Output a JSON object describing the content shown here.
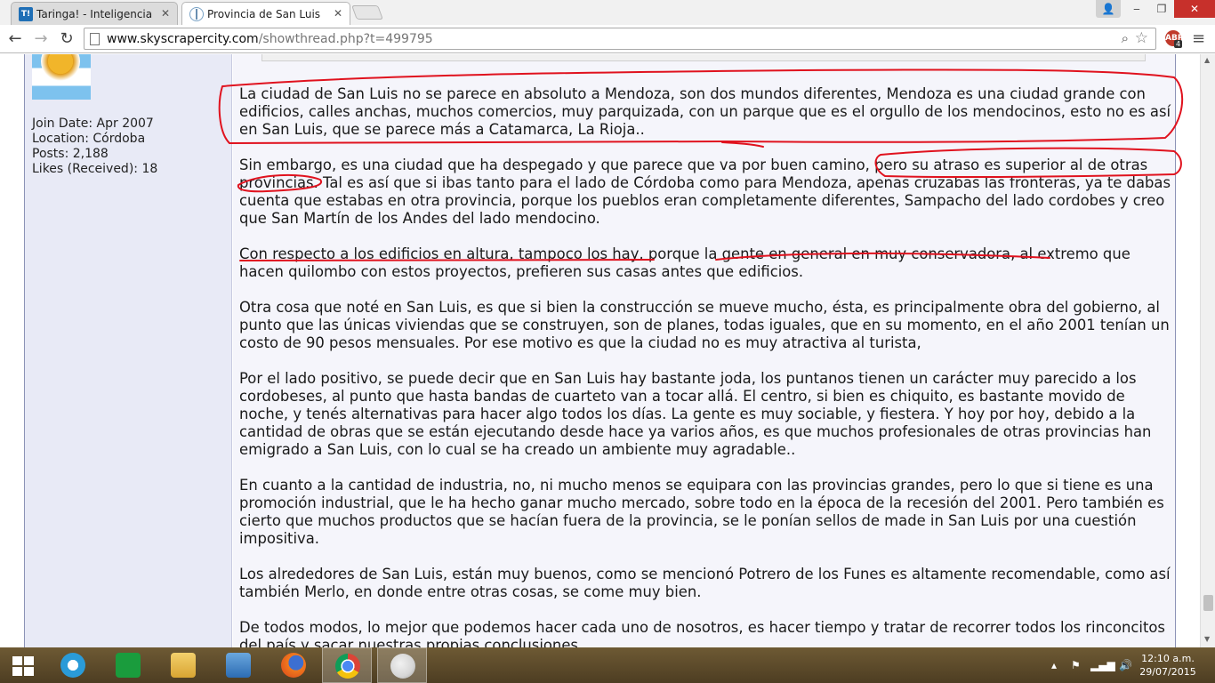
{
  "browser": {
    "tabs": [
      {
        "title": "Taringa! - Inteligencia col",
        "favicon": "taringa-favicon-icon",
        "active": false
      },
      {
        "title": "Provincia de San Luis com",
        "favicon": "skyscrapercity-favicon-icon",
        "active": true
      }
    ],
    "url_host": "www.skyscrapercity.com",
    "url_rest": "/showthread.php?t=499795",
    "extension_badge": "4",
    "window_controls": [
      "minimize-icon",
      "maximize-icon",
      "close-icon"
    ]
  },
  "user": {
    "join_date": "Join Date: Apr 2007",
    "location": "Location: Córdoba",
    "posts": "Posts: 2,188",
    "likes": "Likes (Received): 18"
  },
  "post": {
    "paragraphs": [
      "La ciudad de San Luis no se parece en absoluto a Mendoza, son dos mundos diferentes, Mendoza es una ciudad grande con edificios, calles anchas, muchos comercios, muy parquizada, con un parque que es el orgullo de los mendocinos, esto no es así en San Luis, que se parece más a Catamarca, La Rioja..",
      "Sin embargo, es una ciudad que ha despegado y que parece que va por buen camino, pero su atraso es superior al de otras provincias. Tal es así que si ibas tanto para el lado de Córdoba como para Mendoza, apenas cruzabas las fronteras, ya te dabas cuenta que estabas en otra provincia, porque los pueblos eran completamente diferentes, Sampacho del lado cordobes y creo que San Martín de los Andes del lado mendocino.",
      "Con respecto a los edificios en altura, tampoco los hay, porque la gente en general en muy conservadora, al extremo que hacen quilombo con estos proyectos, prefieren sus casas antes que edificios.",
      "Otra cosa que noté en San Luis, es que si bien la construcción se mueve mucho, ésta, es principalmente obra del gobierno, al punto que las únicas viviendas que se construyen, son de planes, todas iguales, que en su momento, en el año 2001 tenían un costo de 90 pesos mensuales. Por ese motivo es que la ciudad no es muy atractiva al turista,",
      "Por el lado positivo, se puede decir que en San Luis hay bastante joda, los puntanos tienen un carácter muy parecido a los cordobeses, al punto que hasta bandas de cuarteto van a tocar allá. El centro, si bien es chiquito, es bastante movido de noche, y tenés alternativas para hacer algo todos los días. La gente es muy sociable, y fiestera. Y hoy por hoy, debido a la cantidad de obras que se están ejecutando desde hace ya varios años, es que muchos profesionales de otras provincias han emigrado a San Luis, con lo cual se ha creado un ambiente muy agradable..",
      "En cuanto a la cantidad de industria, no, ni mucho menos se equipara con las provincias grandes, pero lo que si tiene es una promoción industrial, que le ha hecho ganar mucho mercado, sobre todo en la época de la recesión del 2001. Pero también es cierto que muchos productos que se hacían fuera de la provincia, se le ponían sellos de made in San Luis por una cuestión impositiva.",
      "Los alrededores de San Luis, están muy buenos, como se mencionó Potrero de los Funes es altamente recomendable, como así también Merlo, en donde entre otras cosas, se come muy bien.",
      "De todos modos, lo mejor que podemos hacer cada uno de nosotros, es hacer tiempo y tratar de recorrer todos los rinconcitos del país y sacar nuestras propias conclusiones."
    ]
  },
  "annotation_color": "#e0121e",
  "taskbar": {
    "apps": [
      "start-icon",
      "internet-explorer-icon",
      "store-icon",
      "file-explorer-icon",
      "control-panel-icon",
      "firefox-icon",
      "chrome-icon",
      "paint-icon"
    ],
    "time": "12:10 a.m.",
    "date": "29/07/2015"
  }
}
